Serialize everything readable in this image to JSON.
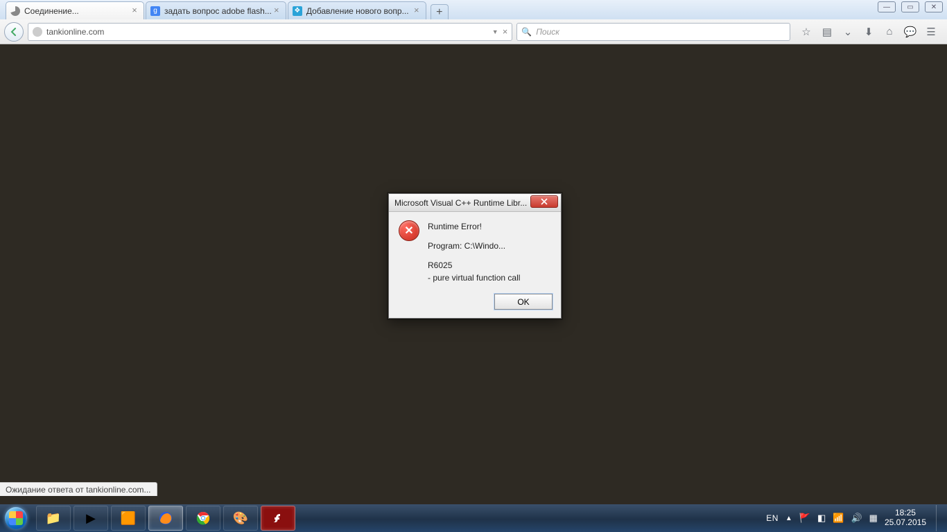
{
  "browser": {
    "tabs": [
      {
        "title": "Соединение...",
        "favicon": "loading"
      },
      {
        "title": "задать вопрос adobe flash...",
        "favicon": "google"
      },
      {
        "title": "Добавление нового вопр...",
        "favicon": "site"
      }
    ],
    "url": "tankionline.com",
    "search_placeholder": "Поиск",
    "status": "Ожидание ответа от tankionline.com..."
  },
  "dialog": {
    "title": "Microsoft Visual C++ Runtime Libr...",
    "heading": "Runtime Error!",
    "program_line": "Program: C:\\Windo...",
    "code": "R6025",
    "detail": "- pure virtual function call",
    "ok": "OK"
  },
  "taskbar": {
    "lang": "EN",
    "time": "18:25",
    "date": "25.07.2015"
  }
}
